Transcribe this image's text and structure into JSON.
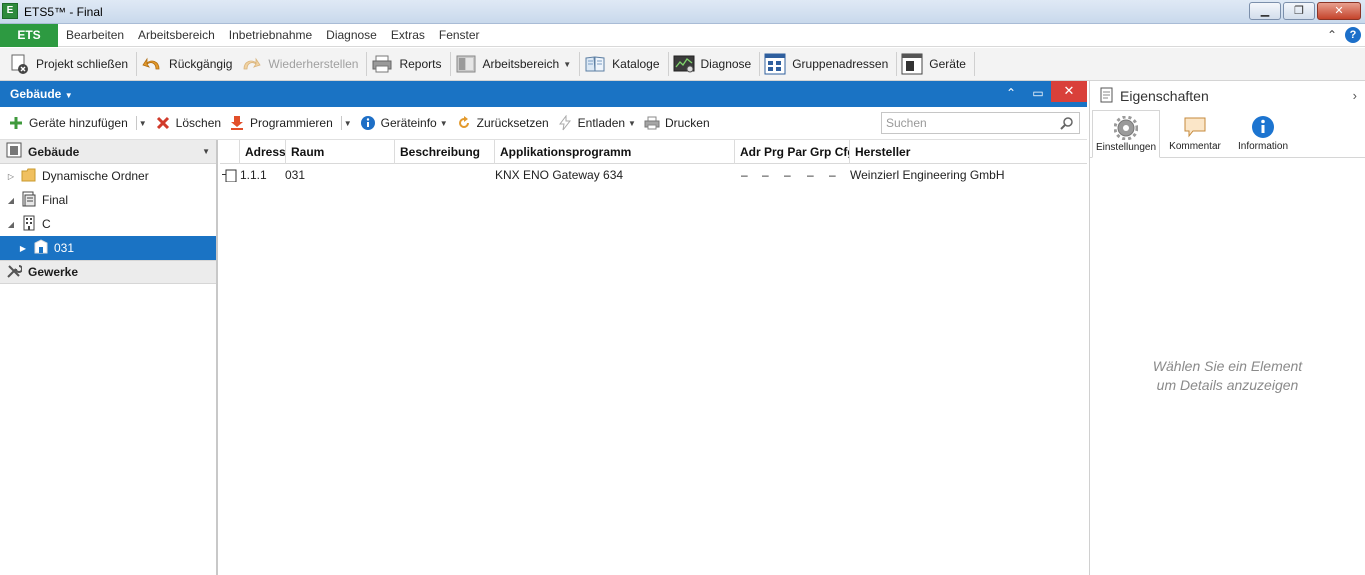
{
  "window": {
    "title": "ETS5™ - Final",
    "icon": "ets-app-icon",
    "controls": [
      "minimize",
      "restore",
      "close"
    ]
  },
  "menubar": {
    "ets_button": "ETS",
    "items": [
      "Bearbeiten",
      "Arbeitsbereich",
      "Inbetriebnahme",
      "Diagnose",
      "Extras",
      "Fenster"
    ]
  },
  "ribbon": {
    "buttons": [
      {
        "label": "Projekt schließen",
        "icon": "close-project-icon",
        "enabled": true
      },
      {
        "label": "Rückgängig",
        "icon": "undo-icon",
        "enabled": true
      },
      {
        "label": "Wiederherstellen",
        "icon": "redo-icon",
        "enabled": false
      },
      {
        "label": "Reports",
        "icon": "printer-icon",
        "enabled": true
      },
      {
        "label": "Arbeitsbereich",
        "icon": "workspace-icon",
        "enabled": true,
        "dropdown": true
      },
      {
        "label": "Kataloge",
        "icon": "catalog-icon",
        "enabled": true
      },
      {
        "label": "Diagnose",
        "icon": "diagnostics-icon",
        "enabled": true
      },
      {
        "label": "Gruppenadressen",
        "icon": "group-addresses-icon",
        "enabled": true
      },
      {
        "label": "Geräte",
        "icon": "devices-icon",
        "enabled": true
      }
    ]
  },
  "panel": {
    "title": "Gebäude",
    "toolbar": {
      "add_devices": "Geräte hinzufügen",
      "delete": "Löschen",
      "program": "Programmieren",
      "device_info": "Geräteinfo",
      "reset": "Zurücksetzen",
      "unload": "Entladen",
      "print": "Drucken",
      "search_placeholder": "Suchen"
    }
  },
  "tree": {
    "header": "Gebäude",
    "items": [
      {
        "label": "Dynamische Ordner",
        "icon": "folder-icon",
        "level": 0,
        "expander": "collapsed-empty"
      },
      {
        "label": "Final",
        "icon": "project-icon",
        "level": 0,
        "expander": "expanded"
      },
      {
        "label": "C",
        "icon": "building-icon",
        "level": 0,
        "expander": "expanded"
      },
      {
        "label": "031",
        "icon": "room-icon",
        "level": 1,
        "expander": "collapsed",
        "selected": true
      }
    ],
    "gewerke": "Gewerke"
  },
  "grid": {
    "columns": [
      "Adresse",
      "Raum",
      "Beschreibung",
      "Applikationsprogramm",
      "Adr Prg Par Grp Cfg",
      "Hersteller"
    ],
    "rows": [
      {
        "address": "1.1.1",
        "room": "031",
        "description": "",
        "application": "KNX ENO Gateway 634",
        "flags": [
          "–",
          "–",
          "–",
          "–",
          "–"
        ],
        "manufacturer": "Weinzierl Engineering GmbH"
      }
    ]
  },
  "properties": {
    "title": "Eigenschaften",
    "tabs": [
      {
        "label": "Einstellungen",
        "icon": "gear-icon",
        "active": true
      },
      {
        "label": "Kommentar",
        "icon": "comment-icon",
        "active": false
      },
      {
        "label": "Information",
        "icon": "info-icon",
        "active": false
      }
    ],
    "empty_message_line1": "Wählen Sie ein Element",
    "empty_message_line2": "um Details anzuzeigen"
  },
  "colors": {
    "ets_green": "#2d9a41",
    "panel_blue": "#1a73c4",
    "close_red": "#d9403a"
  }
}
